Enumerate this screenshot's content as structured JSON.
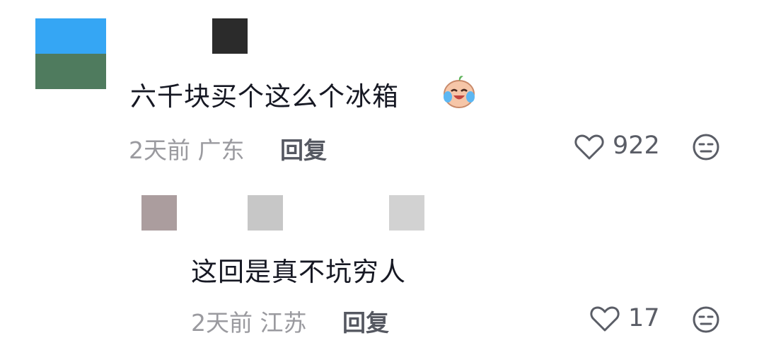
{
  "comments": [
    {
      "text": "六千块买个这么个冰箱",
      "emoji": "laugh-crying-emoji",
      "time": "2天前",
      "location": "广东",
      "reply_label": "回复",
      "likes": "922",
      "icons": {
        "like": "heart-outline-icon",
        "dislike": "dislike-face-icon"
      }
    },
    {
      "text": "这回是真不坑穷人",
      "time": "2天前",
      "location": "江苏",
      "reply_label": "回复",
      "likes": "17",
      "icons": {
        "like": "heart-outline-icon",
        "dislike": "dislike-face-icon"
      }
    }
  ],
  "colors": {
    "text": "#161823",
    "meta": "#9a9a9f",
    "reply": "#555861",
    "avatar_top": "#35a6f4",
    "avatar_bottom": "#4f7b5e"
  }
}
